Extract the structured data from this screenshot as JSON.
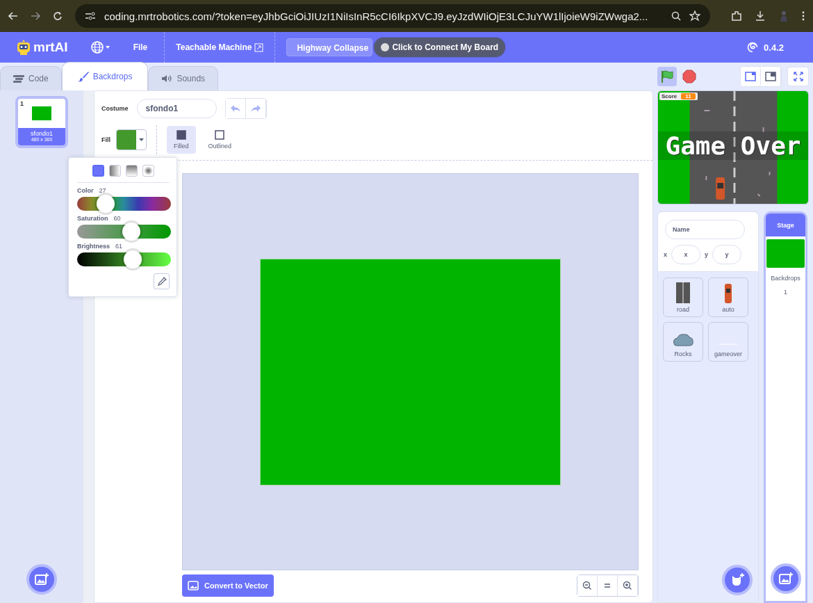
{
  "browser": {
    "url": "coding.mrtrobotics.com/?token=eyJhbGciOiJIUzI1NiIsInR5cCI6IkpXVCJ9.eyJzdWIiOjE3LCJuYW1lIjoieW9iZWwga2..."
  },
  "menu": {
    "logo": "mrtAI",
    "items": [
      {
        "label": "File",
        "kind": "menu"
      },
      {
        "label": "Teachable Machine",
        "kind": "link"
      }
    ],
    "project_title": "Highway Collapse",
    "connect": "Click to Connect My Board",
    "version": "0.4.2"
  },
  "tabs": [
    {
      "label": "Code",
      "kind": "code",
      "selected": false
    },
    {
      "label": "Backdrops",
      "kind": "backdrops",
      "selected": true
    },
    {
      "label": "Sounds",
      "kind": "sounds",
      "selected": false
    }
  ],
  "costumes": [
    {
      "number": "1",
      "name": "sfondo1",
      "size": "480 x 360",
      "selected": true
    }
  ],
  "editor": {
    "costume_label": "Costume",
    "costume_name": "sfondo1",
    "fill_label": "Fill",
    "styles": [
      {
        "label": "Filled",
        "kind": "filled",
        "selected": true
      },
      {
        "label": "Outlined",
        "kind": "outlined",
        "selected": false
      }
    ],
    "convert_button": "Convert to Vector"
  },
  "color_picker": {
    "modes": [
      {
        "kind": "solid",
        "selected": true
      },
      {
        "kind": "horizontal",
        "selected": false
      },
      {
        "kind": "vertical",
        "selected": false
      },
      {
        "kind": "radial",
        "selected": false
      }
    ],
    "sliders": [
      {
        "label": "Color",
        "value": "27",
        "kind": "hue",
        "level": 0.3
      },
      {
        "label": "Saturation",
        "value": "60",
        "kind": "saturation",
        "level": 0.58
      },
      {
        "label": "Brightness",
        "value": "61",
        "kind": "brightness",
        "level": 0.59
      }
    ]
  },
  "stage": {
    "score_label": "Score",
    "score": "11",
    "overlay": "Game Over"
  },
  "sprite_info": {
    "name_placeholder": "Name",
    "x_label": "x",
    "x_placeholder": "x",
    "y_label": "y",
    "y_placeholder": "y"
  },
  "sprites": [
    {
      "name": "road",
      "kind": "road"
    },
    {
      "name": "auto",
      "kind": "car"
    },
    {
      "name": "Rocks",
      "kind": "rocks"
    },
    {
      "name": "gameover",
      "kind": "text"
    }
  ],
  "stage_panel": {
    "title": "Stage",
    "backdrops_label": "Backdrops",
    "backdrops_count": "1"
  }
}
